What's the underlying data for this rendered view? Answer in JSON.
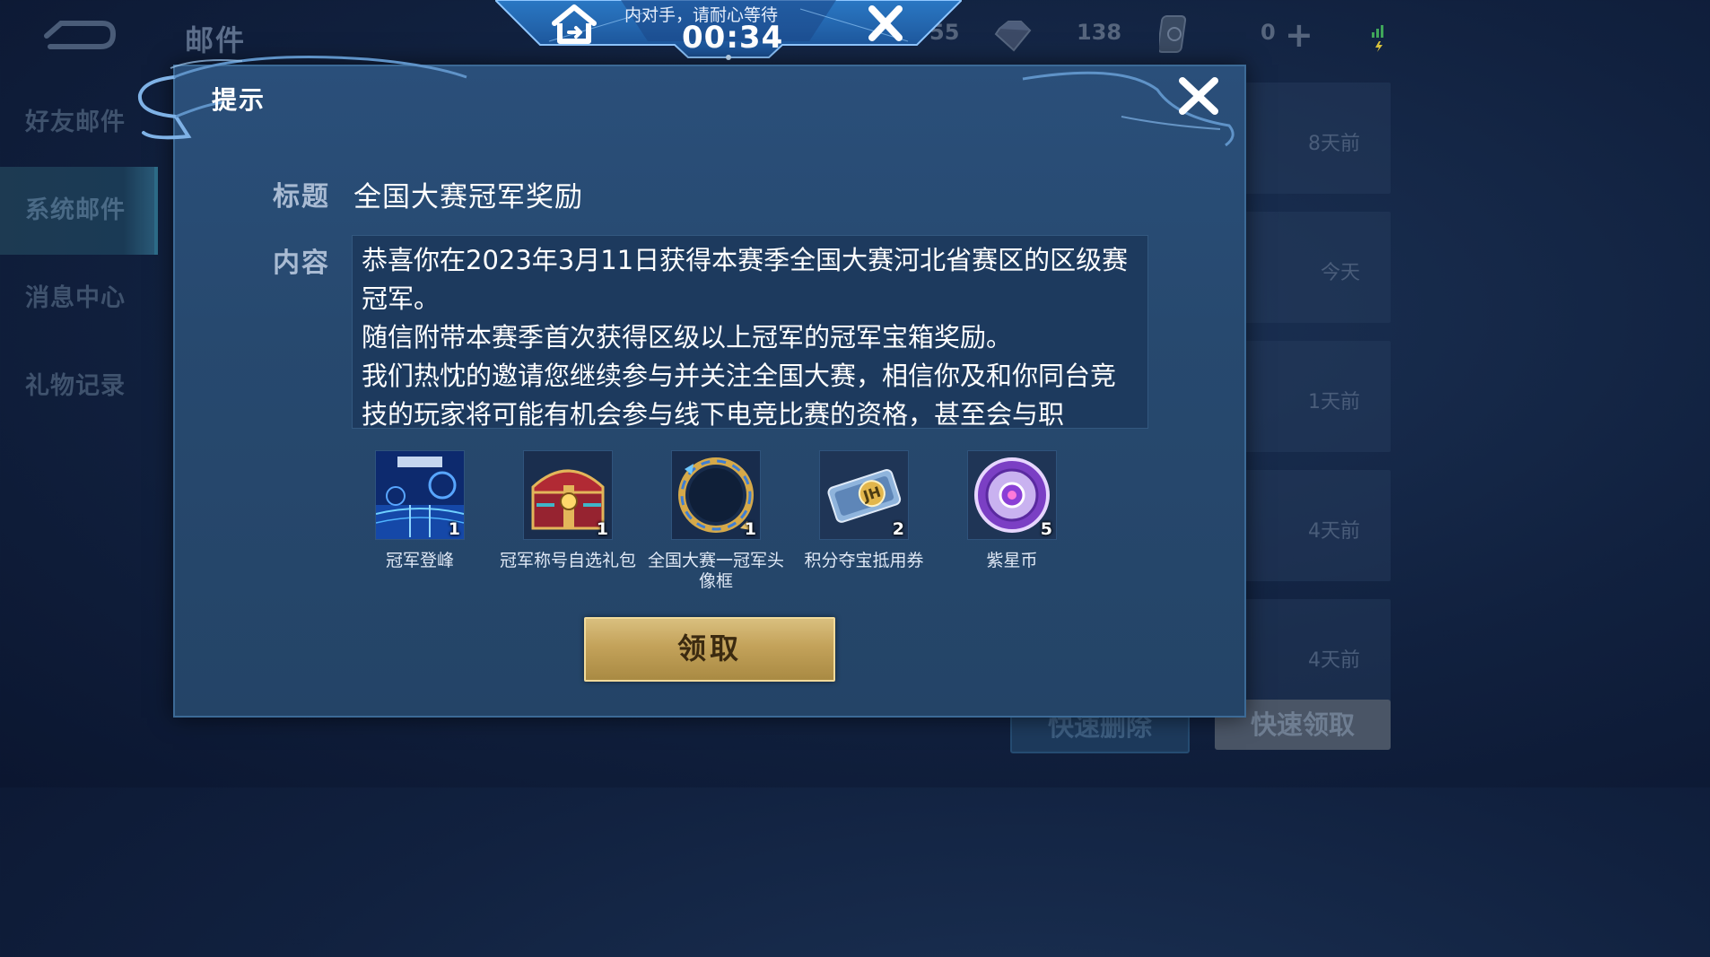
{
  "header": {
    "page_title": "邮件",
    "back_icon": "back-arrow-icon"
  },
  "sidebar": {
    "items": [
      {
        "label": "好友邮件",
        "active": false
      },
      {
        "label": "系统邮件",
        "active": true
      },
      {
        "label": "消息中心",
        "active": false
      },
      {
        "label": "礼物记录",
        "active": false
      }
    ]
  },
  "mail_list": {
    "times": [
      "8天前",
      "今天",
      "1天前",
      "4天前",
      "4天前"
    ]
  },
  "bottom_actions": {
    "delete_label": "快速删除",
    "claim_all_label": "快速领取"
  },
  "resources": {
    "partial_value": "55",
    "gems": "138",
    "cards": "0",
    "add_icon": "plus-icon"
  },
  "matching": {
    "status_text": "内对手，请耐心等待",
    "timer": "00:34",
    "home_icon": "home-icon",
    "cancel_icon": "close-icon"
  },
  "dialog": {
    "title": "提示",
    "subject_label": "标题",
    "subject_value": "全国大赛冠军奖励",
    "content_label": "内容",
    "content_lines": [
      "恭喜你在2023年3月11日获得本赛季全国大赛河北省赛区的区级赛冠军。",
      "随信附带本赛季首次获得区级以上冠军的冠军宝箱奖励。",
      "我们热忱的邀请您继续参与并关注全国大赛，相信你及和你同台竞技的玩家将可能有机会参与线下电竞比赛的资格，甚至会与职"
    ],
    "rewards": [
      {
        "name": "冠军登峰",
        "qty": "1",
        "icon": "champion-peak-icon"
      },
      {
        "name": "冠军称号自选礼包",
        "qty": "1",
        "icon": "treasure-chest-icon"
      },
      {
        "name": "全国大赛一冠军头像框",
        "qty": "1",
        "icon": "avatar-frame-icon"
      },
      {
        "name": "积分夺宝抵用券",
        "qty": "2",
        "icon": "coupon-icon"
      },
      {
        "name": "紫星币",
        "qty": "5",
        "icon": "purple-star-coin-icon"
      }
    ],
    "claim_label": "领取"
  },
  "colors": {
    "modal_bg": "#27496f",
    "claim_gold": "#c3a25a",
    "text_white": "#ffffff"
  }
}
